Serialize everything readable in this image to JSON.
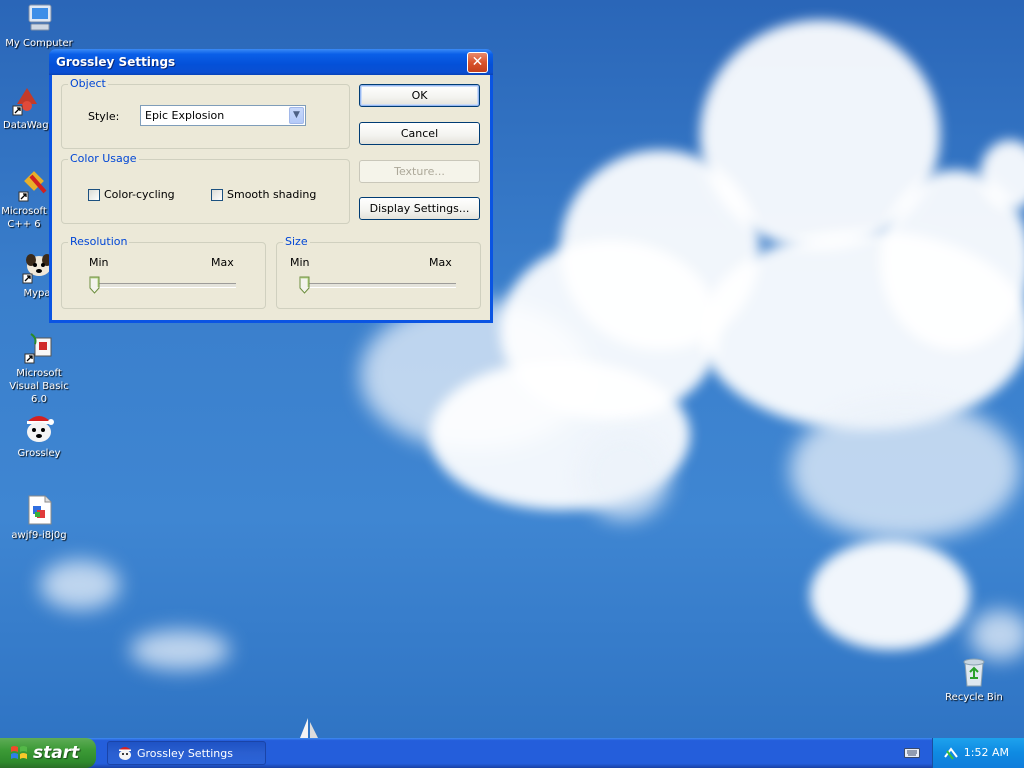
{
  "desktop": {
    "icons": [
      {
        "label": "My Computer"
      },
      {
        "label": "DataWag"
      },
      {
        "label": "Microsoft C++ 6"
      },
      {
        "label": "Mypa"
      },
      {
        "label": "Microsoft Visual Basic 6.0"
      },
      {
        "label": "Grossley"
      },
      {
        "label": "awjf9-i8j0g"
      },
      {
        "label": "Recycle Bin"
      }
    ]
  },
  "window": {
    "title": "Grossley Settings",
    "object_group": {
      "legend": "Object",
      "style_label": "Style:",
      "style_value": "Epic Explosion"
    },
    "color_group": {
      "legend": "Color Usage",
      "color_cycling_label": "Color-cycling",
      "color_cycling_checked": false,
      "smooth_shading_label": "Smooth shading",
      "smooth_shading_checked": false
    },
    "resolution_group": {
      "legend": "Resolution",
      "min_label": "Min",
      "max_label": "Max",
      "value_fraction": 0
    },
    "size_group": {
      "legend": "Size",
      "min_label": "Min",
      "max_label": "Max",
      "value_fraction": 0
    },
    "buttons": {
      "ok": "OK",
      "cancel": "Cancel",
      "texture": "Texture...",
      "display_settings": "Display Settings..."
    }
  },
  "taskbar": {
    "start_label": "start",
    "task_label": "Grossley Settings",
    "clock": "1:52 AM"
  },
  "colors": {
    "title_blue": "#0a54e3",
    "dialog_face": "#ece9d8",
    "group_legend": "#0046d5",
    "start_green": "#3c9a36",
    "taskbar_blue": "#245edb"
  }
}
